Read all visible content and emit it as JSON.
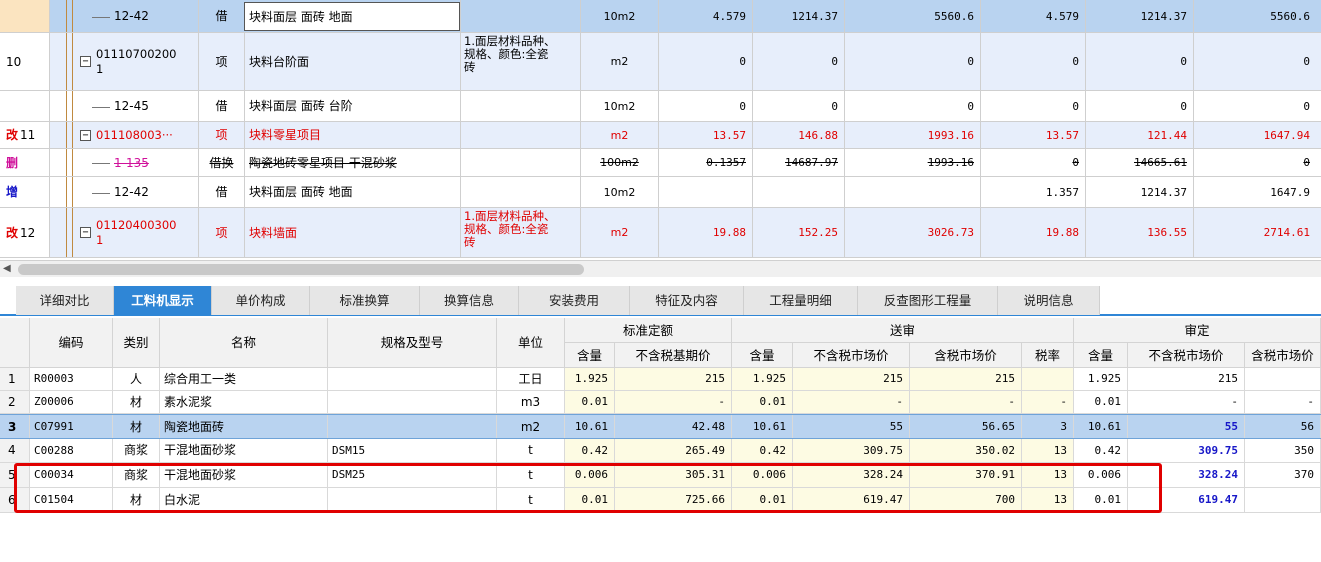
{
  "upper_rows": [
    {
      "idx": "",
      "mark": "",
      "code": "12-42",
      "type": "借",
      "name": "块料面层 面砖 地面",
      "spec": "",
      "unit": "10m2",
      "qty": "4.579",
      "price": "1214.37",
      "total": "5560.6",
      "qty2": "4.579",
      "price2": "1214.37",
      "total2": "5560.6"
    },
    {
      "idx": "10",
      "mark": "",
      "code1": "01110700200",
      "code2": "1",
      "type": "项",
      "name": "块料台阶面",
      "spec1": "1.面层材料品种、",
      "spec2": "规格、颜色:全瓷",
      "spec3": "砖",
      "unit": "m2",
      "qty": "0",
      "price": "0",
      "total": "0",
      "qty2": "0",
      "price2": "0",
      "total2": "0"
    },
    {
      "idx": "",
      "mark": "",
      "code": "12-45",
      "type": "借",
      "name": "块料面层 面砖 台阶",
      "spec": "",
      "unit": "10m2",
      "qty": "0",
      "price": "0",
      "total": "0",
      "qty2": "0",
      "price2": "0",
      "total2": "0"
    },
    {
      "idx": "11",
      "mark": "改",
      "code": "011108003···",
      "type": "项",
      "name": "块料零星项目",
      "spec": "",
      "unit": "m2",
      "qty": "13.57",
      "price": "146.88",
      "total": "1993.16",
      "qty2": "13.57",
      "price2": "121.44",
      "total2": "1647.94"
    },
    {
      "idx": "",
      "mark": "删",
      "code": "1-135",
      "type": "借换",
      "name": "陶瓷地砖零星项目 干混砂浆",
      "spec": "",
      "unit": "100m2",
      "qty": "0.1357",
      "price": "14687.97",
      "total": "1993.16",
      "qty2": "0",
      "price2": "14665.61",
      "total2": "0"
    },
    {
      "idx": "",
      "mark": "增",
      "code": "12-42",
      "type": "借",
      "name": "块料面层 面砖 地面",
      "spec": "",
      "unit": "10m2",
      "qty": "",
      "price": "",
      "total": "",
      "qty2": "1.357",
      "price2": "1214.37",
      "total2": "1647.9"
    },
    {
      "idx": "12",
      "mark": "改",
      "code1": "01120400300",
      "code2": "1",
      "type": "项",
      "name": "块料墙面",
      "spec1": "1.面层材料品种、",
      "spec2": "规格、颜色:全瓷",
      "spec3": "砖",
      "unit": "m2",
      "qty": "19.88",
      "price": "152.25",
      "total": "3026.73",
      "qty2": "19.88",
      "price2": "136.55",
      "total2": "2714.61"
    }
  ],
  "tabs": [
    "详细对比",
    "工料机显示",
    "单价构成",
    "标准换算",
    "换算信息",
    "安装费用",
    "特征及内容",
    "工程量明细",
    "反查图形工程量",
    "说明信息"
  ],
  "headers": {
    "code": "编码",
    "cat": "类别",
    "name": "名称",
    "spec": "规格及型号",
    "unit": "单位",
    "std": "标准定额",
    "sub": "送审",
    "aud": "审定",
    "qty": "含量",
    "std_price": "不含税基期价",
    "sub_ex": "不含税市场价",
    "sub_inc": "含税市场价",
    "tax": "税率",
    "aud_ex": "不含税市场价",
    "aud_inc": "含税市场价"
  },
  "lower_rows": [
    {
      "n": "1",
      "code": "R00003",
      "cat": "人",
      "name": "综合用工一类",
      "spec": "",
      "unit": "工日",
      "q1": "1.925",
      "p1": "215",
      "q2": "1.925",
      "ex2": "215",
      "inc2": "215",
      "tax": "",
      "q3": "1.925",
      "ex3": "215",
      "inc3": ""
    },
    {
      "n": "2",
      "code": "Z00006",
      "cat": "材",
      "name": "素水泥浆",
      "spec": "",
      "unit": "m3",
      "q1": "0.01",
      "p1": "-",
      "q2": "0.01",
      "ex2": "-",
      "inc2": "-",
      "tax": "-",
      "q3": "0.01",
      "ex3": "-",
      "inc3": "-"
    },
    {
      "n": "3",
      "code": "C07991",
      "cat": "材",
      "name": "陶瓷地面砖",
      "spec": "",
      "unit": "m2",
      "q1": "10.61",
      "p1": "42.48",
      "q2": "10.61",
      "ex2": "55",
      "inc2": "56.65",
      "tax": "3",
      "q3": "10.61",
      "ex3": "55",
      "inc3": "56"
    },
    {
      "n": "4",
      "code": "C00288",
      "cat": "商浆",
      "name": "干混地面砂浆",
      "spec": "DSM15",
      "unit": "t",
      "q1": "0.42",
      "p1": "265.49",
      "q2": "0.42",
      "ex2": "309.75",
      "inc2": "350.02",
      "tax": "13",
      "q3": "0.42",
      "ex3": "309.75",
      "inc3": "350"
    },
    {
      "n": "5",
      "code": "C00034",
      "cat": "商浆",
      "name": "干混地面砂浆",
      "spec": "DSM25",
      "unit": "t",
      "q1": "0.006",
      "p1": "305.31",
      "q2": "0.006",
      "ex2": "328.24",
      "inc2": "370.91",
      "tax": "13",
      "q3": "0.006",
      "ex3": "328.24",
      "inc3": "370"
    },
    {
      "n": "6",
      "code": "C01504",
      "cat": "材",
      "name": "白水泥",
      "spec": "",
      "unit": "t",
      "q1": "0.01",
      "p1": "725.66",
      "q2": "0.01",
      "ex2": "619.47",
      "inc2": "700",
      "tax": "13",
      "q3": "0.01",
      "ex3": "619.47",
      "inc3": ""
    }
  ],
  "colors": {
    "selected_row": "#b9d3f0",
    "item_row": "#e7eefb",
    "tab_active": "#2f86d6",
    "highlight_box": "#e00000",
    "changed_text": "#e00000",
    "audited_text": "#1717c8"
  }
}
